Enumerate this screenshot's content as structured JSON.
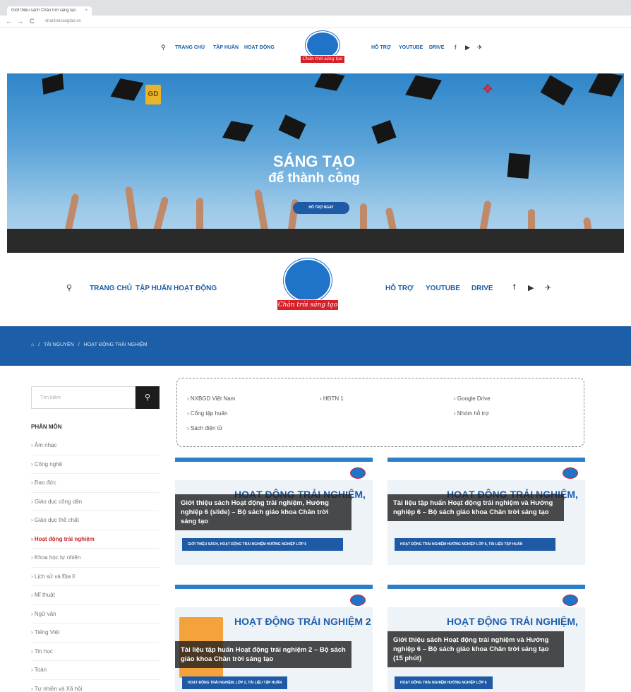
{
  "browser": {
    "tab_title": "Giới thiệu sách Chân trời sáng tạo",
    "tab_close": "×",
    "url": "chantroisangtao.vn",
    "back": "←",
    "forward": "→",
    "reload": "C"
  },
  "logo": {
    "ribbon_text": "Chân trời sáng tạo"
  },
  "top_nav": {
    "search_icon": "⚲",
    "items": [
      "TRANG CHỦ",
      "TẬP HUẤN",
      "HOẠT ĐỘNG",
      "HỖ TRỢ",
      "YOUTUBE",
      "DRIVE"
    ],
    "social": [
      "f",
      "▶",
      "✈"
    ]
  },
  "hero": {
    "badge_left": "GD",
    "title_line1": "SÁNG TẠO",
    "title_line2": "để thành công",
    "button_label": "HỖ TRỢ NGAY",
    "badge_right": "❖"
  },
  "main_nav": {
    "search_icon": "⚲",
    "items": [
      "TRANG CHỦ",
      "TẬP HUẤN",
      "HOẠT ĐỘNG",
      "HỖ TRỢ",
      "YOUTUBE",
      "DRIVE"
    ],
    "social": [
      "f",
      "▶",
      "✈"
    ]
  },
  "breadcrumb": {
    "home_icon": "⌂",
    "sep": "/",
    "items": [
      "TÀI NGUYÊN",
      "HOẠT ĐỘNG TRẢI NGHIỆM"
    ]
  },
  "sidebar": {
    "search_placeholder": "Tìm kiếm",
    "search_button": "⚲",
    "heading": "PHÂN MÔN",
    "items": [
      "Âm nhạc",
      "Công nghệ",
      "Đạo đức",
      "Giáo dục công dân",
      "Giáo dục thể chất",
      "Hoạt động trải nghiệm",
      "Khoa học tự nhiên",
      "Lịch sử và Địa lí",
      "Mĩ thuật",
      "Ngữ văn",
      "Tiếng Việt",
      "Tin học",
      "Toán",
      "Tự nhiên và Xã hội"
    ],
    "active_index": 5,
    "bullet": "›"
  },
  "links": {
    "bullet": "›",
    "items": [
      "NXBGD Việt Nam",
      "HĐTN 1",
      "Google Drive",
      "Cổng tập huấn",
      "Nhóm hỗ trợ",
      "Sách điện tử"
    ]
  },
  "cards": [
    {
      "bg_title": "HOẠT ĐỘNG TRẢI NGHIỆM,",
      "title": "Giới thiệu sách Hoạt động trải nghiệm, Hướng nghiệp 6 (slide) – Bộ sách giáo khoa Chân trời sáng tạo",
      "tags": "GIỚI THIỆU SÁCH, HOẠT ĐỘNG TRẢI NGHIỆM HƯỚNG NGHIỆP LỚP 6"
    },
    {
      "bg_title": "HOẠT ĐỘNG TRẢI NGHIỆM,",
      "title": "Tài liệu tập huấn Hoạt động trải nghiệm và Hướng nghiệp 6 – Bộ sách giáo khoa Chân trời sáng tạo",
      "tags": "HOẠT ĐỘNG TRẢI NGHIỆM HƯỚNG NGHIỆP LỚP 6, TÀI LIỆU TẬP HUẤN"
    },
    {
      "bg_title": "HOẠT ĐỘNG TRẢI NGHIỆM 2",
      "title": "Tài liệu tập huấn Hoạt động trải nghiệm 2 – Bộ sách giáo khoa Chân trời sáng tạo",
      "tags": "HOẠT ĐỘNG TRẢI NGHIỆM, LỚP 2, TÀI LIỆU TẬP HUẤN"
    },
    {
      "bg_title": "HOẠT ĐỘNG TRẢI NGHIỆM,",
      "title": "Giới thiệu sách Hoạt động trải nghiệm và Hướng nghiệp 6 – Bộ sách giáo khoa Chân trời sáng tạo (15 phút)",
      "tags": "HOẠT ĐỘNG TRẢI NGHIỆM HƯỚNG NGHIỆP LỚP 6"
    }
  ],
  "colors": {
    "brand_blue": "#1d5ea8",
    "accent_red": "#c8262b",
    "link_blue": "#1a5fa8"
  }
}
